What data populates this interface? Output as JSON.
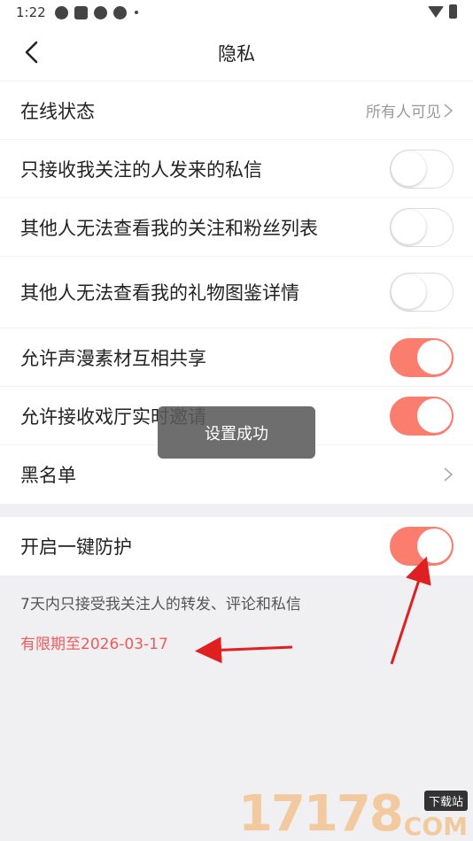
{
  "status_bar": {
    "time": "1:22"
  },
  "nav": {
    "title": "隐私"
  },
  "privacy": {
    "online_status": {
      "label": "在线状态",
      "value": "所有人可见"
    },
    "toggles": [
      {
        "label": "只接收我关注的人发来的私信",
        "on": false
      },
      {
        "label": "其他人无法查看我的关注和粉丝列表",
        "on": false
      },
      {
        "label": "其他人无法查看我的礼物图鉴详情",
        "on": false
      },
      {
        "label": "允许声漫素材互相共享",
        "on": true
      },
      {
        "label": "允许接收戏厅实时邀请",
        "on": true
      }
    ],
    "blacklist": {
      "label": "黑名单"
    }
  },
  "protection": {
    "label": "开启一键防护",
    "on": true,
    "description": "7天内只接受我关注人的转发、评论和私信",
    "expiry": "有限期至2026-03-17"
  },
  "toast": {
    "text": "设置成功"
  },
  "watermark": {
    "number": "17178",
    "badge": "下载站",
    "suffix": "COM"
  },
  "colors": {
    "accent": "#fa7d6e",
    "expiry_text": "#f05a5a",
    "annotation_arrow": "#e02020"
  }
}
